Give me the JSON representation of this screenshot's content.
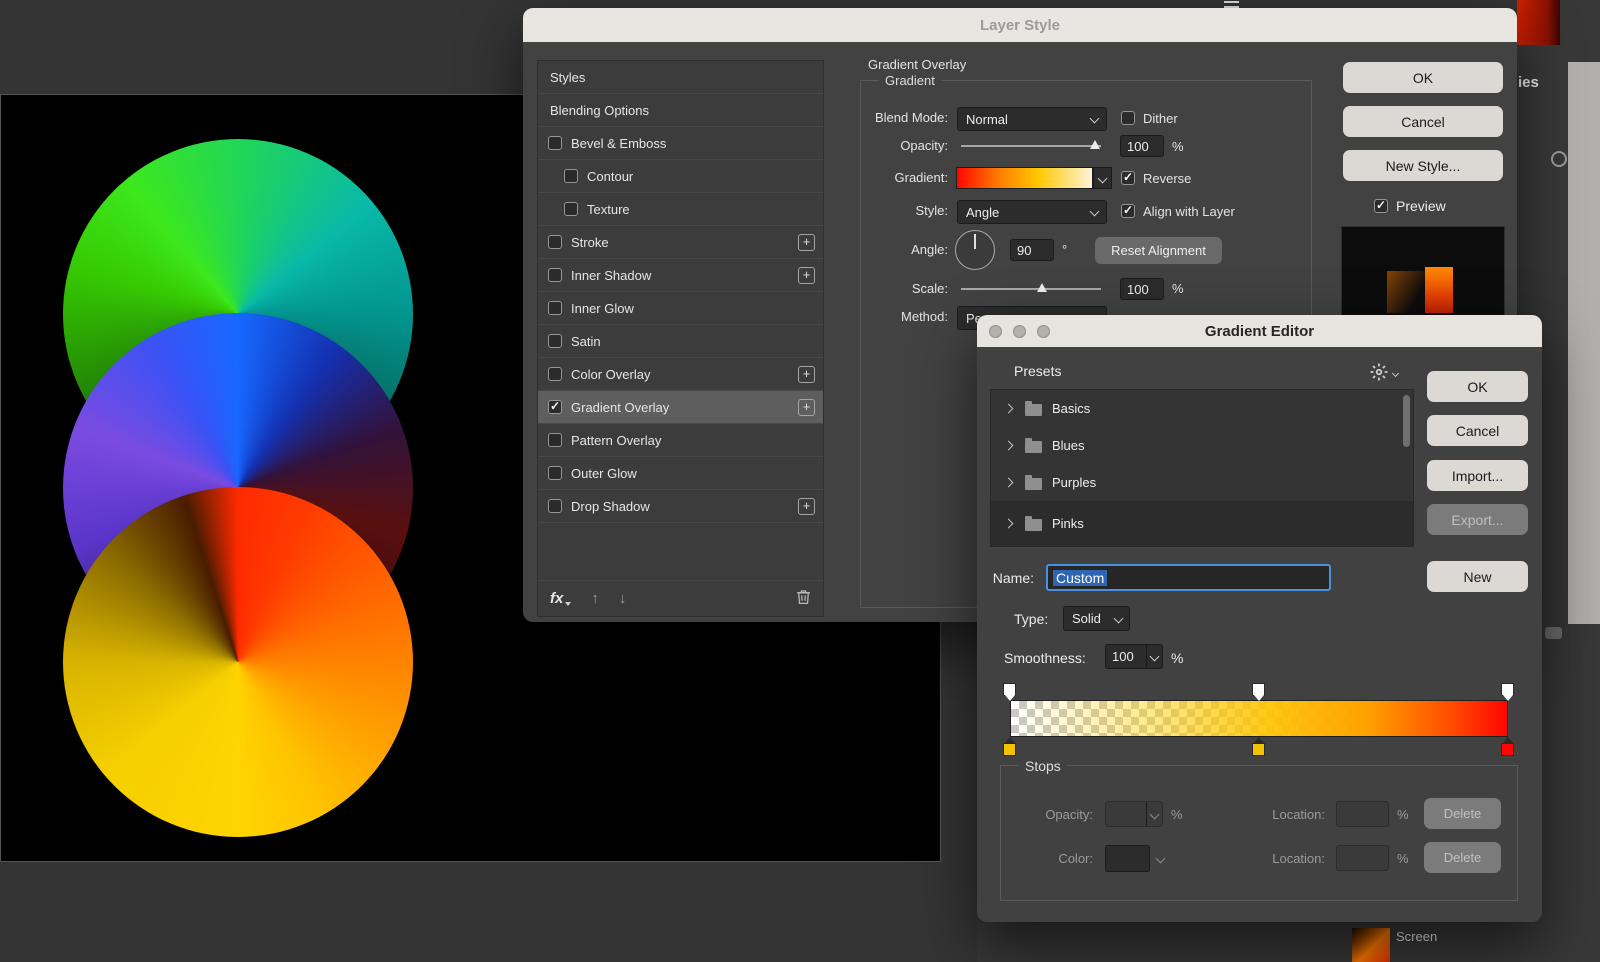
{
  "canvas": {
    "circles": [
      "green-teal-wheel",
      "blue-purple-wheel",
      "red-orange-yellow-wheel"
    ]
  },
  "layer_style": {
    "title": "Layer Style",
    "list": {
      "items": [
        {
          "label": "Styles"
        },
        {
          "label": "Blending Options"
        },
        {
          "label": "Bevel & Emboss",
          "checkbox": true,
          "checked": false
        },
        {
          "label": "Contour",
          "checkbox": true,
          "checked": false,
          "indent": true
        },
        {
          "label": "Texture",
          "checkbox": true,
          "checked": false,
          "indent": true
        },
        {
          "label": "Stroke",
          "checkbox": true,
          "checked": false,
          "plus": true
        },
        {
          "label": "Inner Shadow",
          "checkbox": true,
          "checked": false,
          "plus": true
        },
        {
          "label": "Inner Glow",
          "checkbox": true,
          "checked": false
        },
        {
          "label": "Satin",
          "checkbox": true,
          "checked": false
        },
        {
          "label": "Color Overlay",
          "checkbox": true,
          "checked": false,
          "plus": true
        },
        {
          "label": "Gradient Overlay",
          "checkbox": true,
          "checked": true,
          "plus": true,
          "selected": true
        },
        {
          "label": "Pattern Overlay",
          "checkbox": true,
          "checked": false
        },
        {
          "label": "Outer Glow",
          "checkbox": true,
          "checked": false
        },
        {
          "label": "Drop Shadow",
          "checkbox": true,
          "checked": false,
          "plus": true
        }
      ],
      "fx_label": "fx"
    },
    "panel": {
      "section_title": "Gradient Overlay",
      "group_label": "Gradient",
      "blend_mode_label": "Blend Mode:",
      "blend_mode_value": "Normal",
      "dither_label": "Dither",
      "dither_checked": false,
      "opacity_label": "Opacity:",
      "opacity_value": "100",
      "opacity_unit": "%",
      "opacity_thumb_pct": 96,
      "gradient_label": "Gradient:",
      "reverse_label": "Reverse",
      "reverse_checked": true,
      "style_label": "Style:",
      "style_value": "Angle",
      "align_label": "Align with Layer",
      "align_checked": true,
      "angle_label": "Angle:",
      "angle_value": "90",
      "angle_unit": "°",
      "reset_button": "Reset Alignment",
      "scale_label": "Scale:",
      "scale_value": "100",
      "scale_unit": "%",
      "scale_thumb_pct": 58,
      "method_label": "Method:",
      "method_value_visible": "Pe"
    },
    "actions": {
      "ok": "OK",
      "cancel": "Cancel",
      "new_style": "New Style...",
      "preview_label": "Preview",
      "preview_checked": true
    }
  },
  "gradient_editor": {
    "title": "Gradient Editor",
    "presets_label": "Presets",
    "preset_folders": [
      "Basics",
      "Blues",
      "Purples",
      "Pinks"
    ],
    "actions": {
      "ok": "OK",
      "cancel": "Cancel",
      "import": "Import...",
      "export": "Export...",
      "new": "New"
    },
    "name_label": "Name:",
    "name_value": "Custom",
    "type_label": "Type:",
    "type_value": "Solid",
    "smoothness_label": "Smoothness:",
    "smoothness_value": "100",
    "smoothness_unit": "%",
    "stops_section": {
      "legend": "Stops",
      "opacity_label": "Opacity:",
      "opacity_unit": "%",
      "location_label": "Location:",
      "location_unit": "%",
      "color_label": "Color:",
      "delete_label": "Delete",
      "opacity_stop_positions_pct": [
        0,
        50,
        100
      ],
      "color_stops": [
        {
          "position_pct": 0,
          "color": "#f2c300"
        },
        {
          "position_pct": 50,
          "color": "#f2c300"
        },
        {
          "position_pct": 100,
          "color": "#ff0600"
        }
      ]
    }
  },
  "right_edge": {
    "libraries_tab_partial": "ies",
    "layers_blend_mode": "Screen"
  },
  "colors": {
    "selection_blue": "#2e66b3",
    "focus_border": "#4a90e2",
    "dialog_bg": "#424242",
    "titlebar_bg": "#e9e6e2"
  }
}
